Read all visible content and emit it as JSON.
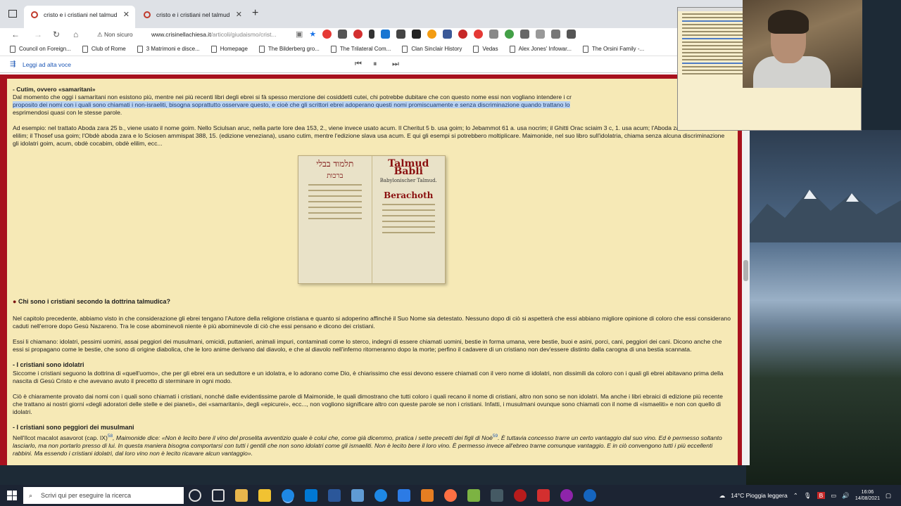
{
  "tabs": [
    {
      "title": "cristo e i cristiani nel talmud",
      "active": true
    },
    {
      "title": "cristo e i cristiani nel talmud",
      "active": false
    }
  ],
  "toolbar": {
    "security": "Non sicuro",
    "url_host": "www.crisinellachiesa.it",
    "url_path": "/articoli/giudaismo/crist..."
  },
  "bookmarks": [
    "Council on Foreign...",
    "Club of Rome",
    "3 Matrimoni e disce...",
    "Homepage",
    "The Bilderberg gro...",
    "The Trilateral Com...",
    "Clan Sinclair History",
    "Vedas",
    "Alex Jones' Infowar...",
    "The Orsini Family -..."
  ],
  "reader": {
    "label": "Leggi ad alta voce"
  },
  "article": {
    "cutim_heading": "- Cutim, ovvero «samaritani»",
    "p1_a": "Dal momento che oggi i samaritani non esistono più, mentre nei più recenti libri degli ebrei si fà spesso menzione dei cosiddetti cutei, chi potrebbe dubitare che con questo nome essi non vogliano intendere i cr",
    "p1_hl": "proposito dei nomi con i quali sono chiamati i non-israeliti, bisogna soprattutto osservare questo, e cioè che gli scrittori ebrei adoperano questi nomi promiscuamente e senza discriminazione quando trattano lo",
    "p1_c": "esprimendosi quasi con le stesse parole.",
    "p2": "Ad esempio: nel trattato Aboda zara 25 b., viene usato il nome goim. Nello Sciulsan aruc, nella parte Iore dea 153, 2., viene invece usato acum. Il Cheritut 5 b. usa goim; lo Jebammot 61 a. usa nocrim; il Ghitti Orac sciaim 3 c, 1. usa acum; l'Aboda zara 2 a., usa obdè elilim; il Thosef usa goim; l'Obdè aboda zara e lo Sciosen ammispat 388, 15. (edizione veneziana), usano cutim, mentre l'edizione slava usa acum. E qui gli esempi si potrebbero moltiplicare. Maimonide, nel suo libro sull'idolatria, chiama senza alcuna discriminazione gli idolatri goim, acum, obdè cocabim, obdè elilim, ecc...",
    "book_left_title": "תלמוד בבלי",
    "book_left_sub": "ברכות",
    "book_right_title": "Talmud Babli",
    "book_right_sub": "Babylonischer Talmud.",
    "book_right_tractate": "Berachoth",
    "section_title": "Chi sono i cristiani secondo la dottrina talmudica",
    "p3": "Nel capitolo precedente, abbiamo visto in che considerazione gli ebrei tengano l'Autore della religione cristiana e quanto si adoperino affinché il Suo Nome sia detestato. Nessuno dopo di ciò si aspetterà che essi abbiano migliore opinione di coloro che essi considerano caduti nell'errore dopo Gesù Nazareno. Tra le cose abominevoli niente è più abominevole di ciò che essi pensano e dicono dei cristiani.",
    "p4": "Essi li chiamano: idolatri, pessimi uomini, assai peggiori dei musulmani, omicidi, puttanieri, animali impuri, contaminati come lo sterco, indegni di essere chiamati uomini, bestie in forma umana, vere bestie, buoi e asini, porci, cani, peggiori dei cani. Dicono anche che essi si propagano come le bestie, che sono di origine diabolica, che le loro anime derivano dal diavolo, e che al diavolo nell'inferno ritorneranno dopo la morte; perfino il cadavere di un cristiano non dev'essere distinto dalla carogna di una bestia scannata.",
    "h_idolatri": "- I cristiani sono idolatri",
    "p5": "Siccome i cristiani seguono la dottrina di «quell'uomo», che per gli ebrei era un seduttore e un idolatra, e lo adorano come Dio, è chiarissimo che essi devono essere chiamati con il vero nome di idolatri, non dissimili da coloro con i quali gli ebrei abitavano prima della nascita di Gesù Cristo e che avevano avuto il precetto di sterminare in ogni modo.",
    "p6": "Ciò è chiaramente provato dai nomi con i quali sono chiamati i cristiani, nonché dalle evidentissime parole di Maimonide, le quali dimostrano che tutti coloro i quali recano il nome di cristiani, altro non sono se non idolatri. Ma anche i libri ebraici di edizione più recente che trattano ai nostri giorni «degli adoratori delle stelle e dei pianeti», dei «samaritani», degli «epicurei», ecc..., non vogliono significare altro con queste parole se non i cristiani. Infatti, i musulmani ovunque sono chiamati con il nome di «ismaeliti» e non con quello di idolatri.",
    "h_musulmani": "- I cristiani sono peggiori dei musulmani",
    "p7_a": "Nell'Ilcot macalot asavorot (cap. IX)",
    "p7_sup1": "58",
    "p7_b": ", Maimonide dice: «Non è lecito bere il vino del proselita avventizio quale è colui che, come già dicemmo, pratica i sette precetti dei figli di Noè",
    "p7_sup2": "59",
    "p7_c": ". È tuttavia concesso trarre un certo vantaggio dal suo vino. Ed è permesso soltanto lasciarlo, ma non portarlo presso di lui. In questa maniera bisogna comportarsi con tutti i gentili che non sono idolatri come gli ismaeliti. Non è lecito bere il loro vino. È permesso invece all'ebreo trarne comunque vantaggio. E in ciò convengono tutti i più eccellenti rabbini. Ma essendo i cristiani idolatri, dal loro vino non è lecito ricavare alcun vantaggio»."
  },
  "taskbar": {
    "search_placeholder": "Scrivi qui per eseguire la ricerca",
    "weather": "14°C  Pioggia leggera",
    "time": "16:06",
    "date": "14/08/2021"
  },
  "colors": {
    "page_bg": "#f6e9b6",
    "page_frame": "#a8111e",
    "selection": "#b9d2f1"
  }
}
